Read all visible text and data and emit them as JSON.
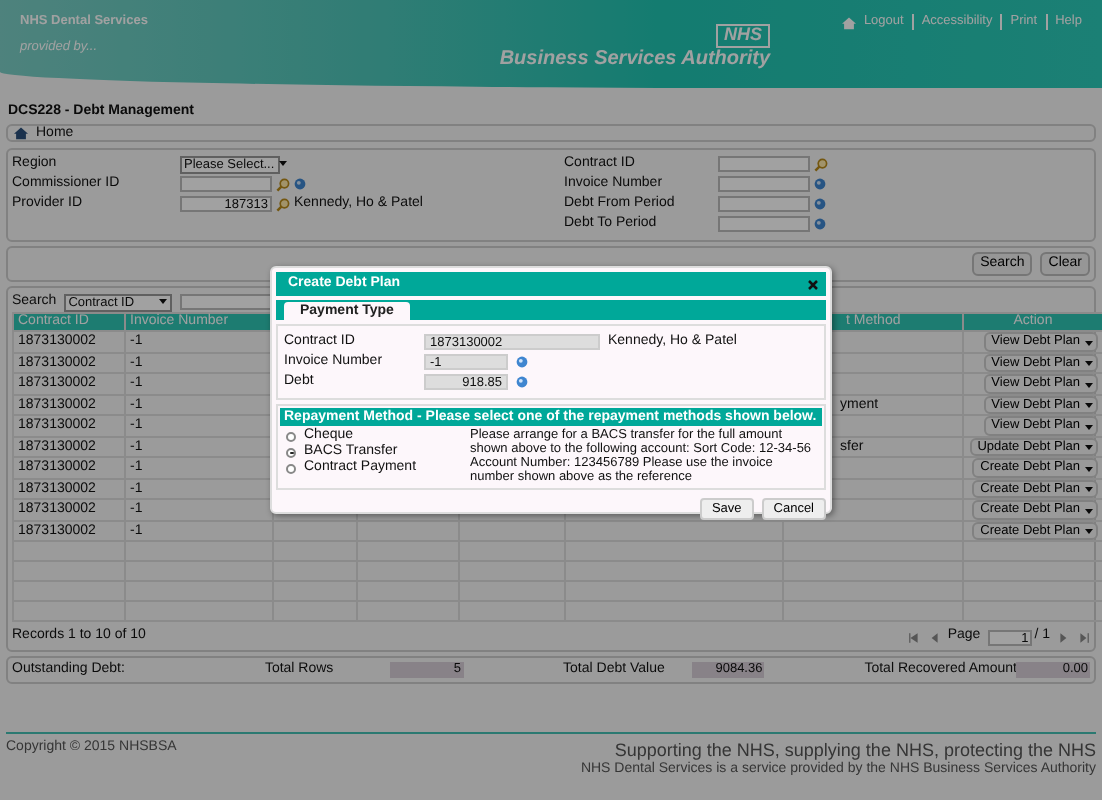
{
  "header": {
    "service": "NHS Dental Services",
    "tagline": "provided by...",
    "logo": "NHS",
    "authority": "Business Services Authority",
    "links": [
      "Logout",
      "Accessibility",
      "Print",
      "Help"
    ]
  },
  "page_title": "DCS228 - Debt Management",
  "breadcrumb": [
    "Home"
  ],
  "filters": {
    "left": [
      {
        "label": "Region",
        "kind": "select",
        "value": "Please Select..."
      },
      {
        "label": "Commissioner ID",
        "kind": "field",
        "lookup": true,
        "help": true
      },
      {
        "label": "Provider ID",
        "kind": "field",
        "value": "187313",
        "lookup": true,
        "note": "Kennedy, Ho & Patel"
      }
    ],
    "right": [
      {
        "label": "Contract ID",
        "kind": "field",
        "lookup": true
      },
      {
        "label": "Invoice Number",
        "kind": "field",
        "help": true
      },
      {
        "label": "Debt From Period",
        "kind": "field",
        "help": true
      },
      {
        "label": "Debt To Period",
        "kind": "field",
        "help": true
      }
    ]
  },
  "filter_buttons": [
    "Search",
    "Clear"
  ],
  "grid": {
    "search": {
      "label": "Search",
      "value": "Contract ID"
    },
    "columns": {
      "contract_id": "Contract ID",
      "invoice_number": "Invoice Number",
      "column_7": "t Method",
      "action": "Action"
    },
    "rows": [
      {
        "contract_id": "1873130002",
        "invoice_number": "-1",
        "action": "View Debt Plan"
      },
      {
        "contract_id": "1873130002",
        "invoice_number": "-1",
        "action": "View Debt Plan"
      },
      {
        "contract_id": "1873130002",
        "invoice_number": "-1",
        "action": "View Debt Plan"
      },
      {
        "contract_id": "1873130002",
        "invoice_number": "-1",
        "column_7": "yment",
        "action": "View Debt Plan"
      },
      {
        "contract_id": "1873130002",
        "invoice_number": "-1",
        "action": "View Debt Plan"
      },
      {
        "contract_id": "1873130002",
        "invoice_number": "-1",
        "column_7": "sfer",
        "action": "Update Debt Plan"
      },
      {
        "contract_id": "1873130002",
        "invoice_number": "-1",
        "action": "Create Debt Plan"
      },
      {
        "contract_id": "1873130002",
        "invoice_number": "-1",
        "action": "Create Debt Plan"
      },
      {
        "contract_id": "1873130002",
        "invoice_number": "-1",
        "action": "Create Debt Plan"
      },
      {
        "contract_id": "1873130002",
        "invoice_number": "-1",
        "action": "Create Debt Plan"
      }
    ],
    "status": "Records 1 to 10 of 10",
    "pager": {
      "label": "Page",
      "page": "1",
      "total": "/ 1"
    }
  },
  "totals": {
    "label": "Outstanding Debt:",
    "items": [
      {
        "label": "Total Rows",
        "value": "5"
      },
      {
        "label": "Total Debt Value",
        "value": "9084.36"
      },
      {
        "label": "Total Recovered Amount",
        "value": "0.00"
      }
    ]
  },
  "footer": {
    "copyright": "Copyright © 2015 NHSBSA",
    "slogan": "Supporting the NHS, supplying the NHS, protecting the NHS",
    "note": "NHS Dental Services is a service provided by the NHS Business Services Authority"
  },
  "modal": {
    "title": "Create Debt Plan",
    "tabs": [
      {
        "label": "Payment Type",
        "selected": true
      }
    ],
    "fields": [
      {
        "label": "Contract ID",
        "kind": "wide",
        "value": "1873130002",
        "note": "Kennedy, Ho & Patel"
      },
      {
        "label": "Invoice Number",
        "kind": "text",
        "value": "-1",
        "help": true
      },
      {
        "label": "Debt",
        "kind": "amount",
        "value": "918.85",
        "help": true
      }
    ],
    "repayment": {
      "heading": "Repayment Method - Please select one of the repayment methods shown below.",
      "options": [
        {
          "label": "Cheque",
          "selected": false
        },
        {
          "label": "BACS Transfer",
          "selected": true
        },
        {
          "label": "Contract Payment",
          "selected": false
        }
      ],
      "instructions": "Please arrange for a BACS transfer for the full amount shown above to the following account: Sort Code: 12-34-56 Account Number: 123456789 Please use the invoice number shown above as the reference"
    },
    "buttons": [
      "Save",
      "Cancel"
    ]
  }
}
